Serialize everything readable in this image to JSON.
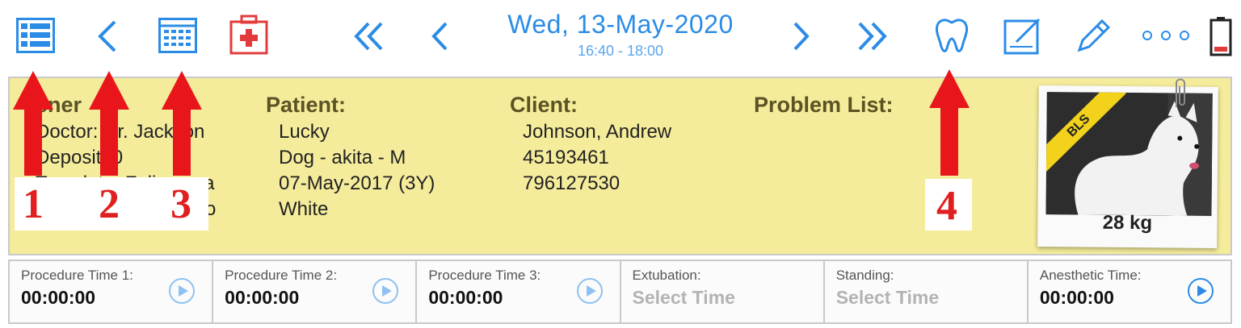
{
  "toolbar": {
    "date_title": "Wed, 13-May-2020",
    "time_range": "16:40 - 18:00",
    "icons": [
      "list-icon",
      "back-chevron-icon",
      "calendar-grid-icon",
      "medical-kit-icon",
      "double-left-icon",
      "left-chevron-icon",
      "right-chevron-icon",
      "double-right-icon",
      "tooth-icon",
      "edit-note-icon",
      "pencil-icon",
      "more-dots-icon",
      "battery-icon"
    ]
  },
  "colors": {
    "accent": "#2b8ce6",
    "panel_bg": "#f5ec9b",
    "header_text": "#5b5324",
    "annotation_red": "#e01f1f",
    "badge": "#f2d21b"
  },
  "general": {
    "header": "ener",
    "lines": [
      "Doctor: Dr. Jackson",
      "Deposit: 0",
      "Template: Feline spa",
      "flo"
    ]
  },
  "patient": {
    "header": "Patient:",
    "lines": [
      "Lucky",
      "Dog - akita - M",
      "07-May-2017 (3Y)",
      "White"
    ]
  },
  "client": {
    "header": "Client:",
    "lines": [
      "Johnson, Andrew",
      "45193461",
      "796127530"
    ]
  },
  "problem_list": {
    "header": "Problem List:"
  },
  "photo": {
    "badge": "BLS",
    "weight": "28 kg"
  },
  "timers": [
    {
      "label": "Procedure Time 1:",
      "value": "00:00:00",
      "placeholder": false,
      "play": "light"
    },
    {
      "label": "Procedure Time 2:",
      "value": "00:00:00",
      "placeholder": false,
      "play": "light"
    },
    {
      "label": "Procedure Time 3:",
      "value": "00:00:00",
      "placeholder": false,
      "play": "light"
    },
    {
      "label": "Extubation:",
      "value": "Select Time",
      "placeholder": true,
      "play": "none"
    },
    {
      "label": "Standing:",
      "value": "Select Time",
      "placeholder": true,
      "play": "none"
    },
    {
      "label": "Anesthetic Time:",
      "value": "00:00:00",
      "placeholder": false,
      "play": "dark"
    }
  ],
  "annotations": {
    "labels": [
      "1",
      "2",
      "3",
      "4"
    ]
  }
}
